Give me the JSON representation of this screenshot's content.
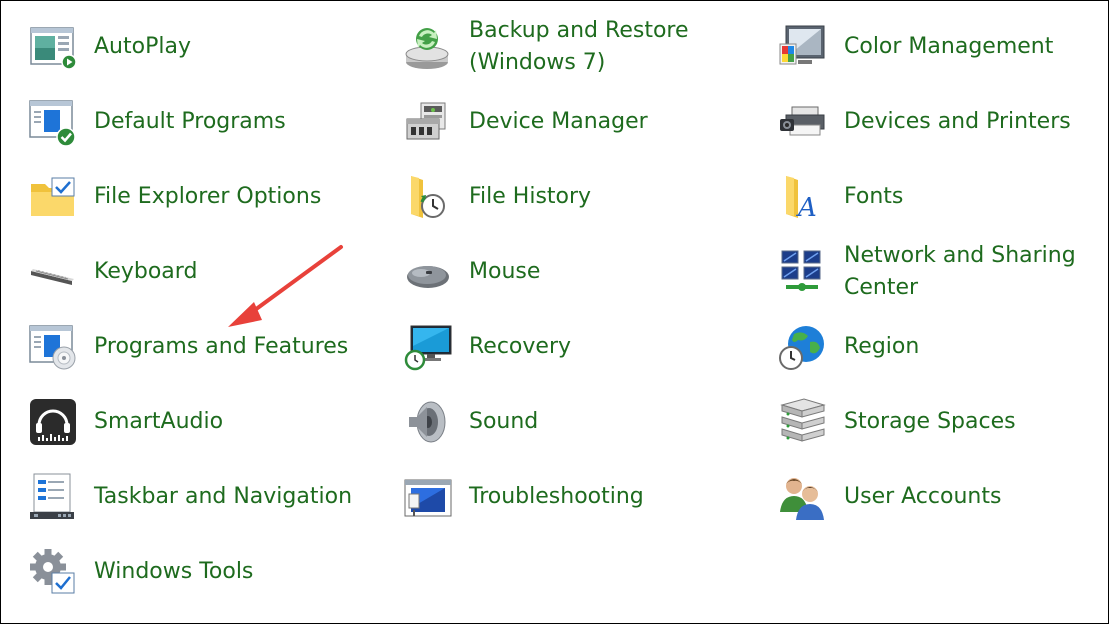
{
  "items": [
    {
      "label": "AutoPlay",
      "icon": "autoplay-icon"
    },
    {
      "label": "Backup and Restore\n(Windows 7)",
      "icon": "backup-restore-icon"
    },
    {
      "label": "Color Management",
      "icon": "color-management-icon"
    },
    {
      "label": "Default Programs",
      "icon": "default-programs-icon"
    },
    {
      "label": "Device Manager",
      "icon": "device-manager-icon"
    },
    {
      "label": "Devices and Printers",
      "icon": "devices-printers-icon"
    },
    {
      "label": "File Explorer Options",
      "icon": "file-explorer-options-icon"
    },
    {
      "label": "File History",
      "icon": "file-history-icon"
    },
    {
      "label": "Fonts",
      "icon": "fonts-icon"
    },
    {
      "label": "Keyboard",
      "icon": "keyboard-icon"
    },
    {
      "label": "Mouse",
      "icon": "mouse-icon"
    },
    {
      "label": "Network and Sharing\nCenter",
      "icon": "network-sharing-icon"
    },
    {
      "label": "Programs and Features",
      "icon": "programs-features-icon"
    },
    {
      "label": "Recovery",
      "icon": "recovery-icon"
    },
    {
      "label": "Region",
      "icon": "region-icon"
    },
    {
      "label": "SmartAudio",
      "icon": "smartaudio-icon"
    },
    {
      "label": "Sound",
      "icon": "sound-icon"
    },
    {
      "label": "Storage Spaces",
      "icon": "storage-spaces-icon"
    },
    {
      "label": "Taskbar and Navigation",
      "icon": "taskbar-navigation-icon"
    },
    {
      "label": "Troubleshooting",
      "icon": "troubleshooting-icon"
    },
    {
      "label": "User Accounts",
      "icon": "user-accounts-icon"
    },
    {
      "label": "Windows Tools",
      "icon": "windows-tools-icon"
    }
  ],
  "colors": {
    "label": "#1e6b1e",
    "annotation_arrow": "#e8413a"
  }
}
